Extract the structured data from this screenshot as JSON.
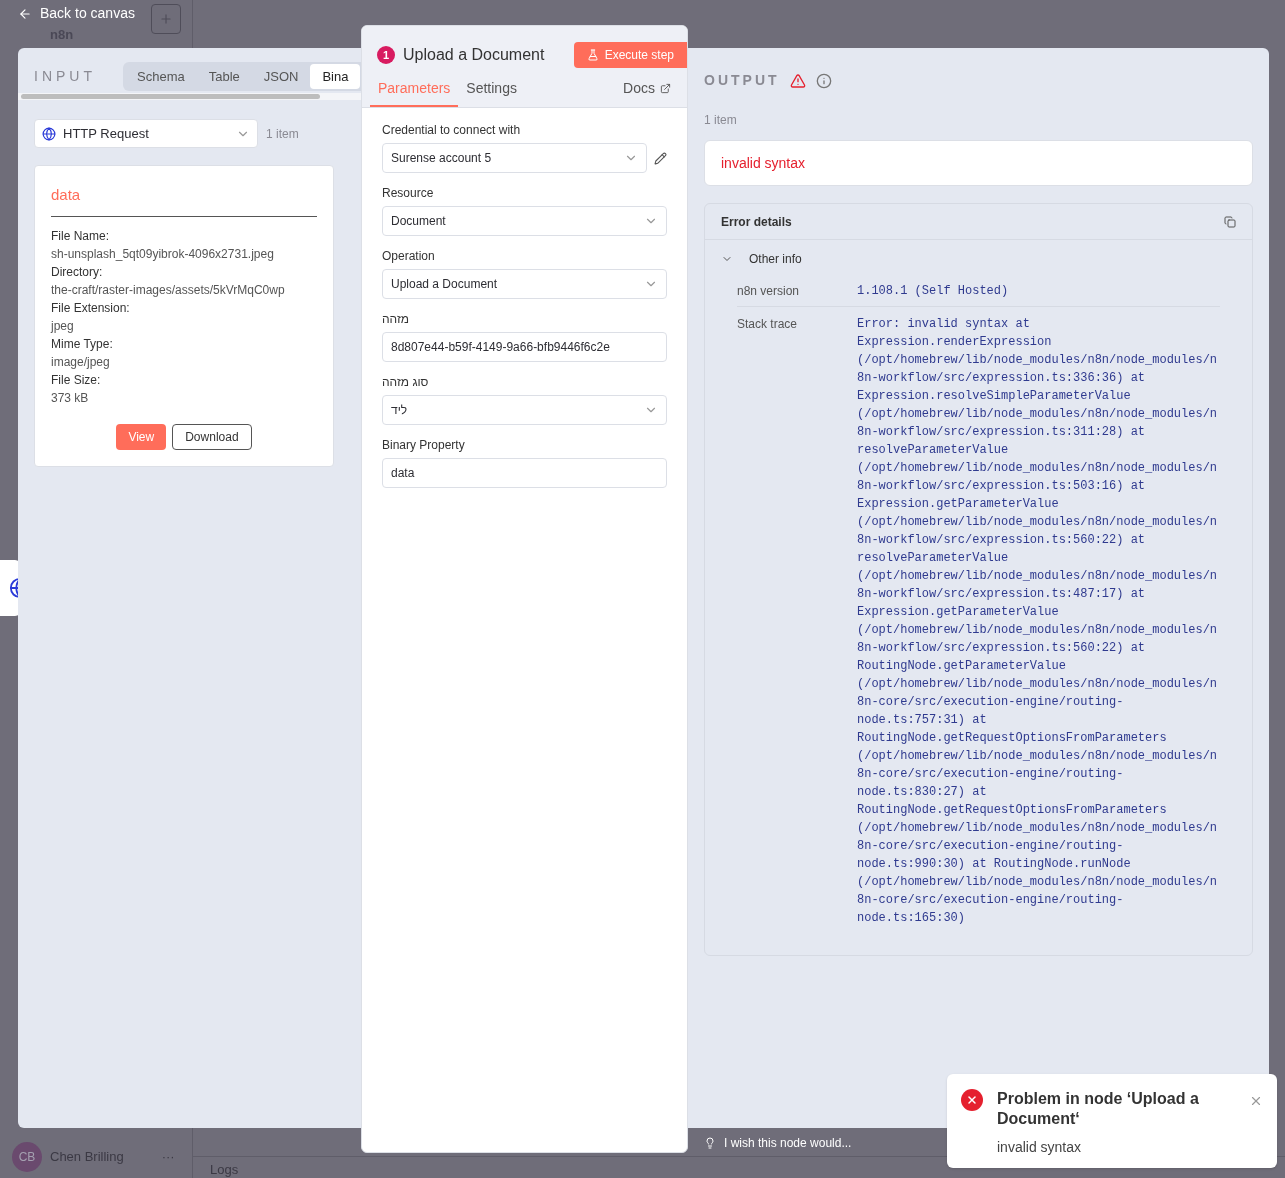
{
  "background": {
    "logo": "n8n",
    "user": {
      "initials": "CB",
      "name": "Chen Brilling",
      "menu": "···"
    },
    "logs": "Logs",
    "feedback": "I wish this node would..."
  },
  "back_link": "Back to canvas",
  "input": {
    "title": "INPUT",
    "tabs": [
      {
        "label": "Schema",
        "selected": false
      },
      {
        "label": "Table",
        "selected": false
      },
      {
        "label": "JSON",
        "selected": false
      },
      {
        "label": "Bina",
        "selected": true
      }
    ],
    "source": "HTTP Request",
    "count": "1 item",
    "binary": {
      "title": "data",
      "fields": [
        {
          "label": "File Name:",
          "value": "sh-unsplash_5qt09yibrok-4096x2731.jpeg"
        },
        {
          "label": "Directory:",
          "value": "the-craft/raster-images/assets/5kVrMqC0wp"
        },
        {
          "label": "File Extension:",
          "value": "jpeg"
        },
        {
          "label": "Mime Type:",
          "value": "image/jpeg"
        },
        {
          "label": "File Size:",
          "value": "373 kB"
        }
      ],
      "buttons": [
        {
          "label": "View",
          "kind": "primary"
        },
        {
          "label": "Download",
          "kind": "secondary"
        }
      ]
    }
  },
  "node": {
    "badge": "1",
    "title": "Upload a Document",
    "execute": "Execute step",
    "tabs": [
      {
        "label": "Parameters",
        "selected": true
      },
      {
        "label": "Settings",
        "selected": false
      }
    ],
    "docs": "Docs",
    "params": [
      {
        "label": "Credential to connect with",
        "kind": "select",
        "value": "Surense account 5",
        "editable": true
      },
      {
        "label": "Resource",
        "kind": "select",
        "value": "Document",
        "editable": false
      },
      {
        "label": "Operation",
        "kind": "select",
        "value": "Upload a Document",
        "editable": false
      },
      {
        "label": "מזהה",
        "kind": "input",
        "value": "8d807e44-b59f-4149-9a66-bfb9446f6c2e",
        "editable": false
      },
      {
        "label": "סוג מזהה",
        "kind": "select",
        "value": "ליד",
        "editable": false
      },
      {
        "label": "Binary Property",
        "kind": "input",
        "value": "data",
        "editable": false
      }
    ]
  },
  "output": {
    "title": "OUTPUT",
    "count": "1 item",
    "error": "invalid syntax",
    "details_title": "Error details",
    "section": {
      "label": "Other info",
      "expanded": true
    },
    "rows": [
      {
        "label": "n8n version",
        "value": "1.108.1 (Self Hosted)"
      },
      {
        "label": "Stack trace",
        "value": "Error: invalid syntax at Expression.renderExpression (/opt/homebrew/lib/node_modules/n8n/node_modules/n8n-workflow/src/expression.ts:336:36) at Expression.resolveSimpleParameterValue (/opt/homebrew/lib/node_modules/n8n/node_modules/n8n-workflow/src/expression.ts:311:28) at resolveParameterValue (/opt/homebrew/lib/node_modules/n8n/node_modules/n8n-workflow/src/expression.ts:503:16) at Expression.getParameterValue (/opt/homebrew/lib/node_modules/n8n/node_modules/n8n-workflow/src/expression.ts:560:22) at resolveParameterValue (/opt/homebrew/lib/node_modules/n8n/node_modules/n8n-workflow/src/expression.ts:487:17) at Expression.getParameterValue (/opt/homebrew/lib/node_modules/n8n/node_modules/n8n-workflow/src/expression.ts:560:22) at RoutingNode.getParameterValue (/opt/homebrew/lib/node_modules/n8n/node_modules/n8n-core/src/execution-engine/routing-node.ts:757:31) at RoutingNode.getRequestOptionsFromParameters (/opt/homebrew/lib/node_modules/n8n/node_modules/n8n-core/src/execution-engine/routing-node.ts:830:27) at RoutingNode.getRequestOptionsFromParameters (/opt/homebrew/lib/node_modules/n8n/node_modules/n8n-core/src/execution-engine/routing-node.ts:990:30) at RoutingNode.runNode (/opt/homebrew/lib/node_modules/n8n/node_modules/n8n-core/src/execution-engine/routing-node.ts:165:30)"
      }
    ]
  },
  "toast": {
    "title": "Problem in node ‘Upload a Document‘",
    "message": "invalid syntax"
  }
}
